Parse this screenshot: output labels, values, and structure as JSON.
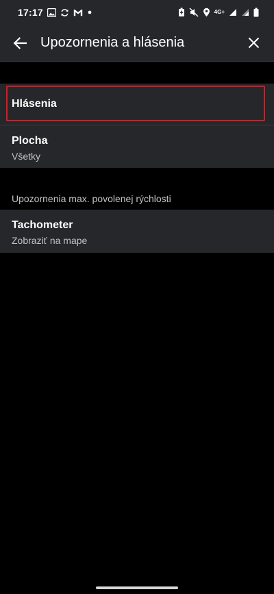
{
  "status_bar": {
    "time": "17:17",
    "network": "4G+",
    "left_icons": [
      "image-icon",
      "sync-icon",
      "gmail-icon",
      "dot-icon"
    ],
    "right_icons": [
      "battery-saver-icon",
      "mute-icon",
      "location-icon",
      "signal-icon",
      "signal-icon-2",
      "battery-icon"
    ]
  },
  "app_bar": {
    "title": "Upozornenia a hlásenia",
    "back_icon": "arrow-left-icon",
    "close_icon": "close-icon"
  },
  "settings": {
    "hlasenia": {
      "title": "Hlásenia"
    },
    "plocha": {
      "title": "Plocha",
      "subtitle": "Všetky"
    },
    "speed_section": {
      "header": "Upozornenia max. povolenej rýchlosti",
      "tachometer": {
        "title": "Tachometer",
        "subtitle": "Zobraziť na mape"
      }
    }
  },
  "colors": {
    "background": "#000000",
    "surface": "#25272a",
    "text_primary": "#ffffff",
    "text_secondary": "#c0c2c6",
    "highlight": "#e3161e"
  }
}
